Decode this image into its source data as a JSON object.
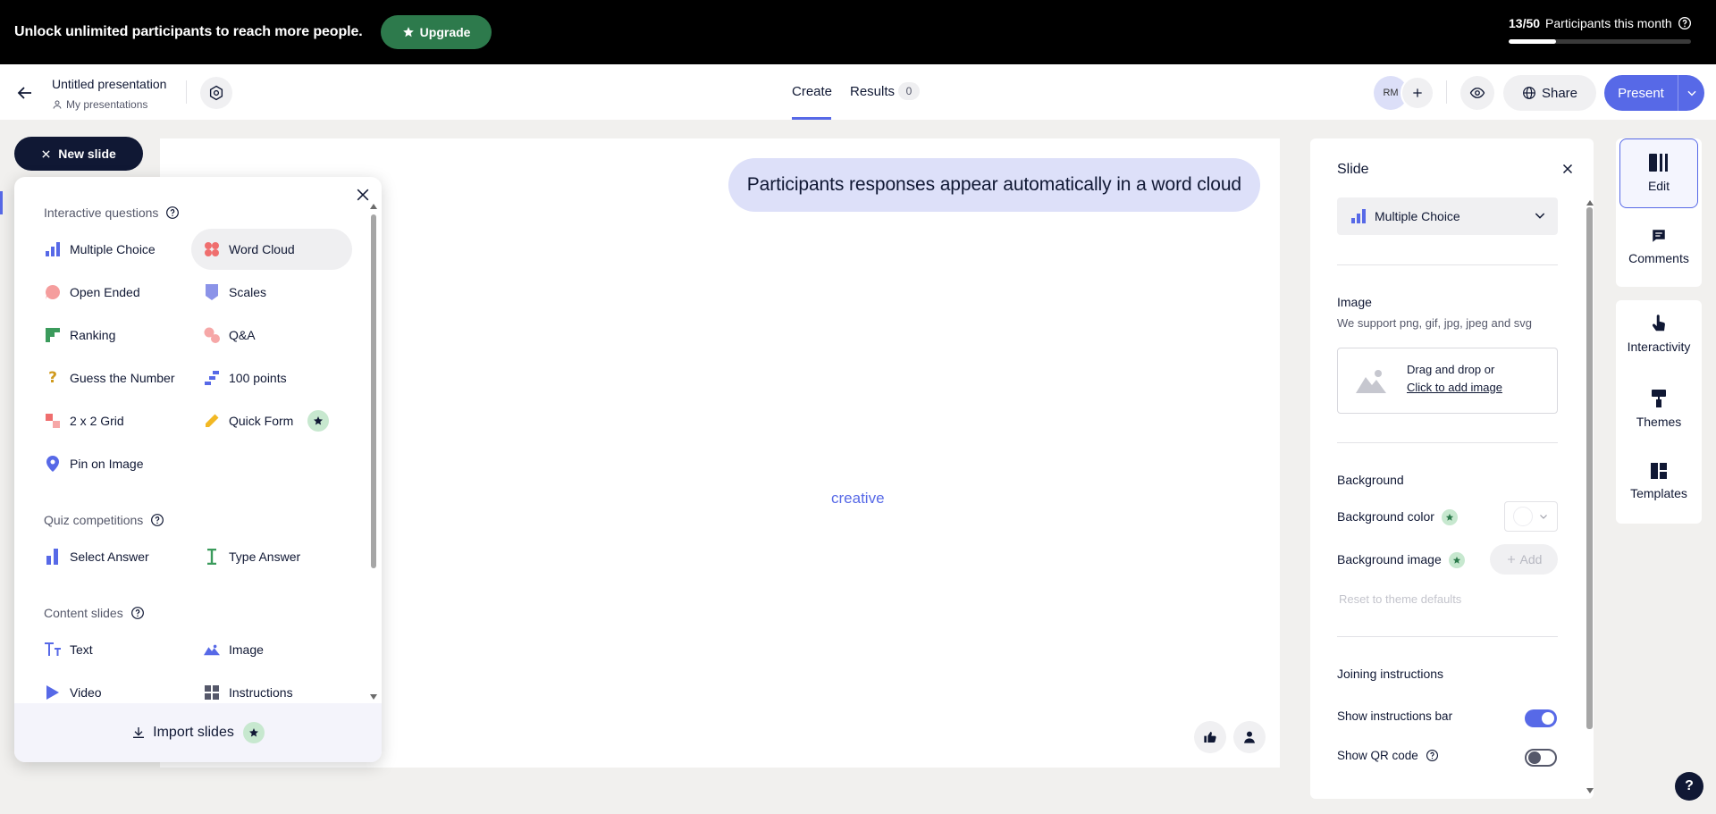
{
  "banner": {
    "text": "Unlock unlimited participants to reach more people.",
    "upgrade_label": "Upgrade",
    "participants_count": "13/50",
    "participants_label": "Participants this month",
    "participants_fraction": 0.26
  },
  "header": {
    "title": "Untitled presentation",
    "folder": "My presentations",
    "tabs": {
      "create": "Create",
      "results": "Results",
      "results_count": "0"
    },
    "avatar_initials": "RM",
    "share_label": "Share",
    "present_label": "Present"
  },
  "new_slide_label": "New slide",
  "slide": {
    "heading": "Participants responses appear automatically in a word cloud",
    "word": "creative"
  },
  "menu": {
    "interactive_title": "Interactive questions",
    "interactive": [
      {
        "label": "Multiple Choice",
        "icon": "bar-chart-icon"
      },
      {
        "label": "Word Cloud",
        "icon": "word-cloud-icon"
      },
      {
        "label": "Open Ended",
        "icon": "speech-bubble-icon"
      },
      {
        "label": "Scales",
        "icon": "scales-icon"
      },
      {
        "label": "Ranking",
        "icon": "ranking-icon"
      },
      {
        "label": "Q&A",
        "icon": "qa-icon"
      },
      {
        "label": "Guess the Number",
        "icon": "question-mark-icon"
      },
      {
        "label": "100 points",
        "icon": "points-icon"
      },
      {
        "label": "2 x 2 Grid",
        "icon": "grid-icon"
      },
      {
        "label": "Quick Form",
        "icon": "pencil-icon"
      },
      {
        "label": "Pin on Image",
        "icon": "pin-icon"
      }
    ],
    "quiz_title": "Quiz competitions",
    "quiz": [
      {
        "label": "Select Answer",
        "icon": "select-answer-icon"
      },
      {
        "label": "Type Answer",
        "icon": "text-cursor-icon"
      }
    ],
    "content_title": "Content slides",
    "content": [
      {
        "label": "Text",
        "icon": "text-icon"
      },
      {
        "label": "Image",
        "icon": "image-icon"
      },
      {
        "label": "Video",
        "icon": "play-icon"
      },
      {
        "label": "Instructions",
        "icon": "instructions-icon"
      }
    ],
    "import_label": "Import slides"
  },
  "panel": {
    "title": "Slide",
    "slide_type": "Multiple Choice",
    "image_title": "Image",
    "image_sub": "We support png, gif, jpg, jpeg and svg",
    "drop_text": "Drag and drop or",
    "drop_link": "Click to add image",
    "background_title": "Background",
    "bg_color_label": "Background color",
    "bg_image_label": "Background image",
    "add_label": "Add",
    "reset_label": "Reset to theme defaults",
    "joining_title": "Joining instructions",
    "instructions_bar_label": "Show instructions bar",
    "instructions_bar_on": true,
    "qr_label": "Show QR code",
    "qr_on": false
  },
  "rail": {
    "edit": "Edit",
    "comments": "Comments",
    "interactivity": "Interactivity",
    "themes": "Themes",
    "templates": "Templates"
  },
  "colors": {
    "accent": "#5769e7",
    "upgrade": "#2d7a4c",
    "dark": "#101834"
  }
}
